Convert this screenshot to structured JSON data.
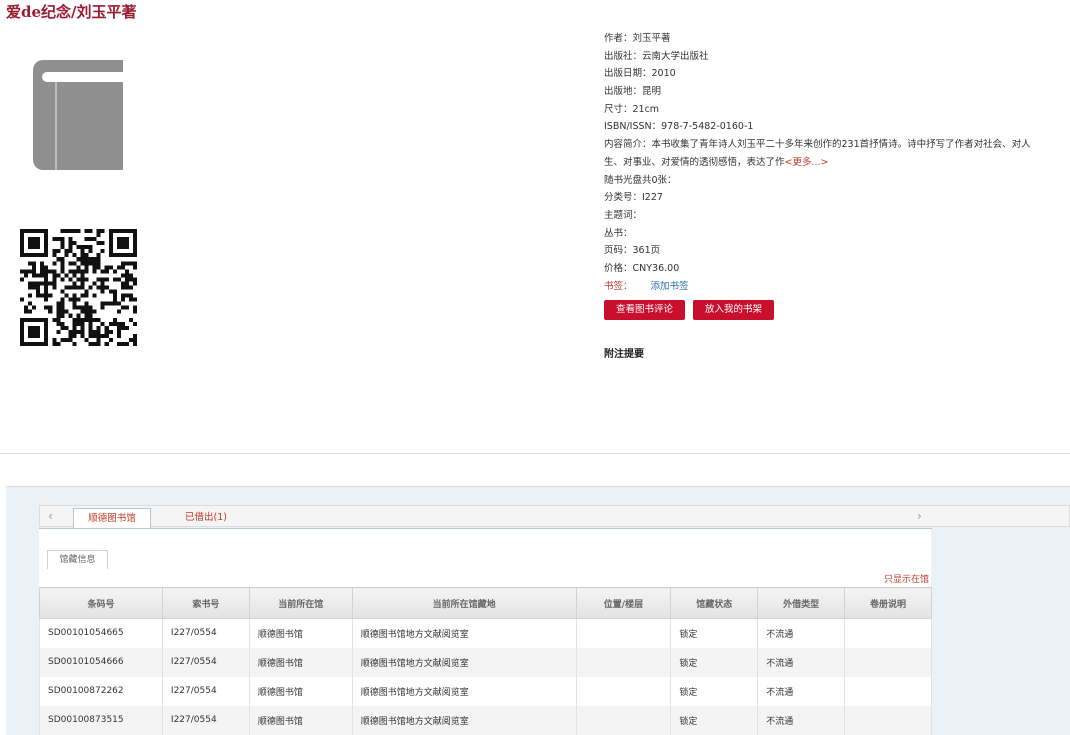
{
  "title": "爱de纪念/刘玉平著",
  "book_info": {
    "author": "作者：刘玉平著",
    "publisher": "出版社：云南大学出版社",
    "pub_date": "出版日期：2010",
    "pub_place": "出版地：昆明",
    "size": "尺寸：21cm",
    "isbn": "ISBN/ISSN：978-7-5482-0160-1",
    "summary": "内容简介：本书收集了青年诗人刘玉平二十多年来创作的231首抒情诗。诗中抒写了作者对社会、对人生、对事业、对爱情的透彻感悟，表达了作",
    "more": "<更多...>",
    "disc": "随书光盘共0张：",
    "class_no": "分类号：I227",
    "subject": "主题词：",
    "series": "丛书：",
    "pages": "页码：361页",
    "price": "价格：CNY36.00",
    "bookmark_label": "书签：",
    "bookmark_link": "添加书签"
  },
  "buttons": {
    "review": "查看图书评论",
    "shelf": "放入我的书架"
  },
  "notes_label": "附注提要",
  "holdings": {
    "tabs": {
      "prev": "‹",
      "next": "›",
      "library": "顺德图书馆",
      "loaned": "已借出(1)"
    },
    "subtab": "馆藏信息",
    "only_show": "只显示在馆",
    "columns": [
      "条码号",
      "索书号",
      "当前所在馆",
      "当前所在馆藏地",
      "位置/楼层",
      "馆藏状态",
      "外借类型",
      "卷册说明"
    ],
    "rows": [
      [
        "SD00101054665",
        "I227/0554",
        "顺德图书馆",
        "顺德图书馆地方文献阅览室",
        "",
        "锁定",
        "不流通",
        ""
      ],
      [
        "SD00101054666",
        "I227/0554",
        "顺德图书馆",
        "顺德图书馆地方文献阅览室",
        "",
        "锁定",
        "不流通",
        ""
      ],
      [
        "SD00100872262",
        "I227/0554",
        "顺德图书馆",
        "顺德图书馆地方文献阅览室",
        "",
        "锁定",
        "不流通",
        ""
      ],
      [
        "SD00100873515",
        "I227/0554",
        "顺德图书馆",
        "顺德图书馆地方文献阅览室",
        "",
        "锁定",
        "不流通",
        ""
      ]
    ]
  },
  "colors": {
    "title": "#9b1b30",
    "button": "#c8102e",
    "link": "#2a6fb0",
    "accent_red": "#c0392b"
  }
}
